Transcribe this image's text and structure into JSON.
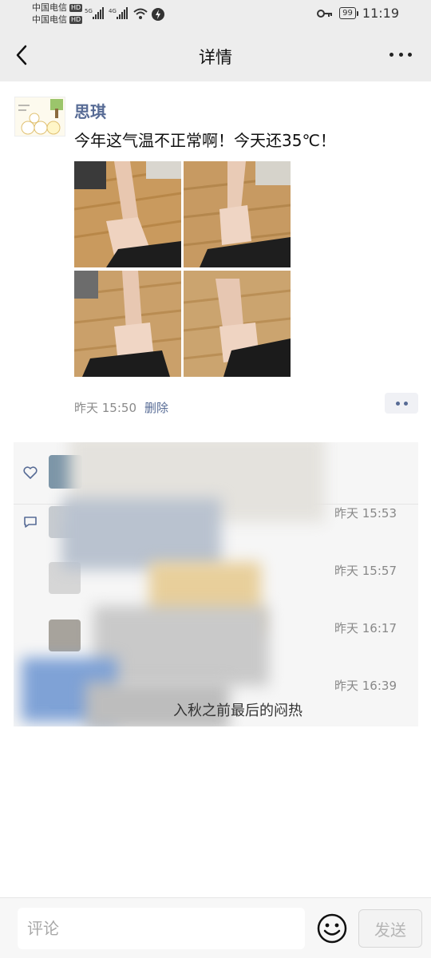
{
  "status_bar": {
    "carrier_1": "中国电信",
    "carrier_2": "中国电信",
    "hd_badge": "HD",
    "network_1": "5G",
    "network_2": "4G",
    "battery": "99",
    "time": "11:19"
  },
  "nav": {
    "title": "详情",
    "back_icon": "chevron-left-icon",
    "more_icon": "more-dots-icon"
  },
  "post": {
    "username": "思琪",
    "text": "今年这气温不正常啊！今天还35℃！",
    "photo_count": 4,
    "time": "昨天 15:50",
    "delete_label": "删除"
  },
  "interactions": {
    "like_icon": "heart-icon",
    "comment_icon": "comment-icon",
    "comments": [
      {
        "time": "昨天 15:53"
      },
      {
        "time": "昨天 15:57"
      },
      {
        "time": "昨天 16:17"
      },
      {
        "time": "昨天 16:39",
        "visible_text": "入秋之前最后的闷热"
      }
    ]
  },
  "bottom": {
    "placeholder": "评论",
    "send_label": "发送",
    "emoji_icon": "smiley-icon"
  }
}
